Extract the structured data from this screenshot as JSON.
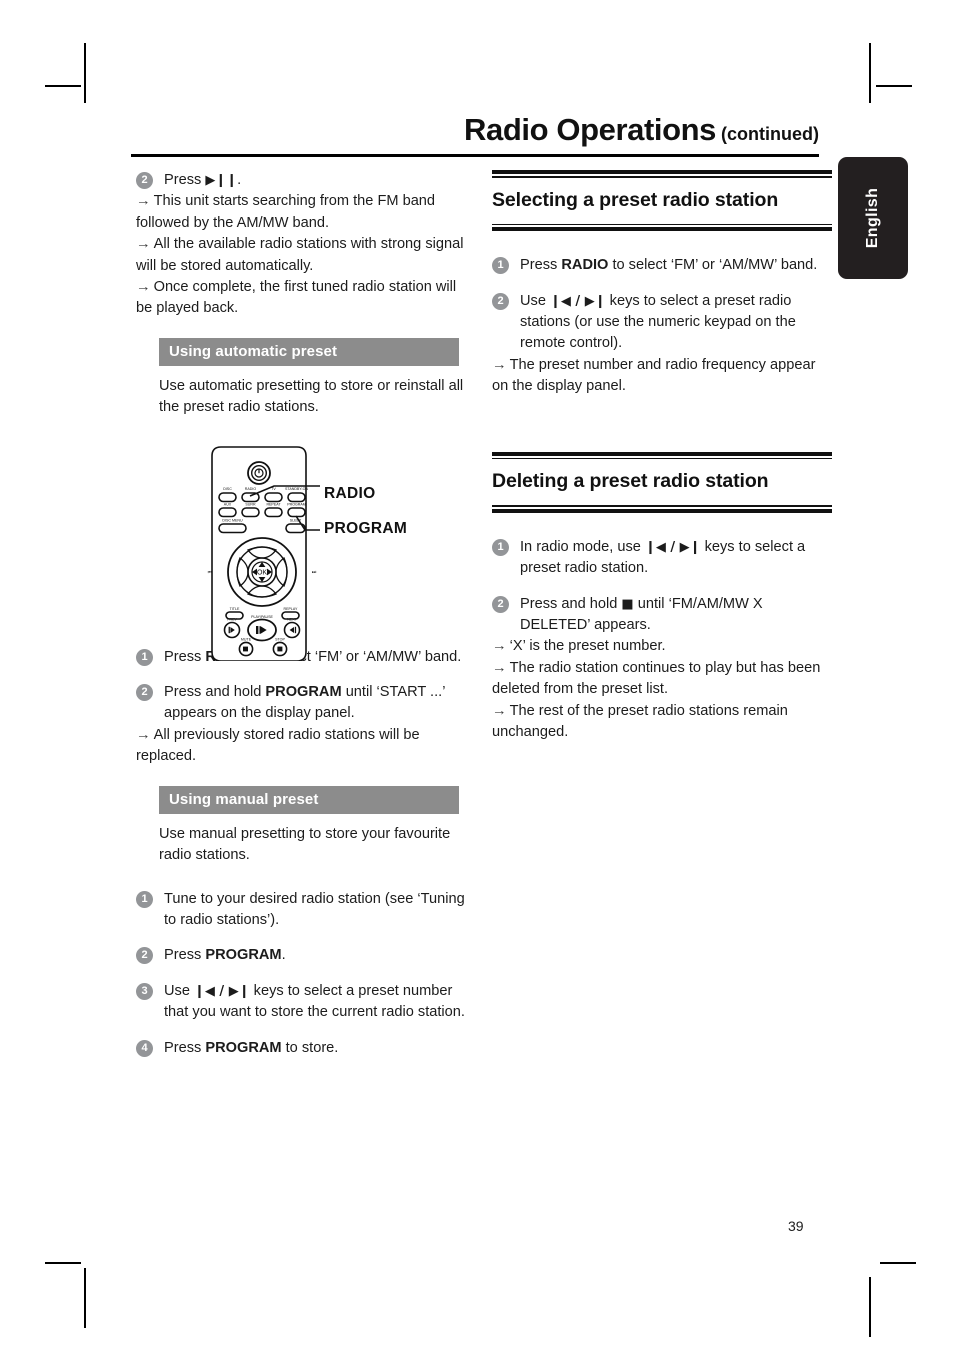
{
  "page": {
    "title_main": "Radio Operations",
    "title_continued": "(continued)",
    "page_number": "39",
    "language_tab": "English",
    "accent_gray": "#8c8c8c",
    "bullet_gray": "#939598",
    "tab_black": "#231f20"
  },
  "left_column": {
    "step2": {
      "num": "2",
      "line1_pre": "Press ",
      "line1_sym": "▶❙❙",
      "line1_post": ".",
      "results": [
        "This unit starts searching from the FM band followed by the AM/MW band.",
        "All the available radio stations with strong signal will be stored automatically.",
        "Once complete, the first tuned radio station will be played back."
      ]
    },
    "auto_preset": {
      "heading": "Using automatic preset",
      "intro": "Use automatic presetting to store or reinstall all the preset radio stations.",
      "steps": [
        {
          "num": "1",
          "pre": "Press ",
          "bold": "RADIO",
          "post": " to select ‘FM’ or ‘AM/MW’ band.",
          "results": []
        },
        {
          "num": "2",
          "pre": "Press and hold ",
          "bold": "PROGRAM",
          "post": " until ‘START ...’ appears on the display panel.",
          "results": [
            "All previously stored radio stations will be replaced."
          ]
        }
      ]
    },
    "manual_preset": {
      "heading": "Using manual preset",
      "intro": "Use manual presetting to store your favourite radio stations.",
      "steps": [
        {
          "num": "1",
          "pre": "Tune to your desired radio station (see ‘Tuning to radio stations’).",
          "bold": "",
          "post": "",
          "results": []
        },
        {
          "num": "2",
          "pre": "Press ",
          "bold": "PROGRAM",
          "post": ".",
          "results": []
        },
        {
          "num": "3",
          "pre": "Use ",
          "sym": "❙◀ / ▶❙",
          "bold": "",
          "post": " keys to select a preset number that you want to store the current radio station.",
          "results": []
        },
        {
          "num": "4",
          "pre": "Press ",
          "bold": "PROGRAM",
          "post": " to store.",
          "results": []
        }
      ]
    }
  },
  "figure": {
    "name": "remote-control-diagram",
    "callouts": [
      "RADIO",
      "PROGRAM"
    ],
    "button_labels": {
      "row1": [
        "DISC",
        "RADIO",
        "TV",
        "STANDBY-ON"
      ],
      "row2": [
        "AUX",
        "SURR",
        "REPEAT",
        "PROGRAM"
      ],
      "row3": [
        "DISC MENU",
        "SLEEP"
      ],
      "dpad_center": "OK",
      "transport": [
        "PREV",
        "PLAY/PAUSE",
        "NEXT"
      ],
      "bottom": [
        "MUTE",
        "STOP"
      ],
      "side_left": "TITLE",
      "side_right": "REPLAY"
    }
  },
  "right_column": {
    "selecting": {
      "title": "Selecting a preset radio station",
      "steps": [
        {
          "num": "1",
          "pre": "Press ",
          "bold": "RADIO",
          "post": " to select ‘FM’ or ‘AM/MW’ band.",
          "results": []
        },
        {
          "num": "2",
          "pre": "Use ",
          "sym": "❙◀ / ▶❙",
          "post": " keys to select a preset radio stations (or use the numeric keypad on the remote control).",
          "results": [
            "The preset number and radio frequency appear on the display panel."
          ]
        }
      ]
    },
    "deleting": {
      "title": "Deleting a preset radio station",
      "steps": [
        {
          "num": "1",
          "pre": "In radio mode, use ",
          "sym": "❙◀ / ▶❙",
          "post": " keys to select a preset radio station.",
          "results": []
        },
        {
          "num": "2",
          "pre": "Press and hold ",
          "sym": "■",
          "post": " until ‘FM/AM/MW X DELETED’ appears.",
          "results": [
            "‘X’ is the preset number.",
            "The radio station continues to play but has been deleted from the preset list.",
            "The rest of the preset radio stations remain unchanged."
          ]
        }
      ]
    }
  }
}
